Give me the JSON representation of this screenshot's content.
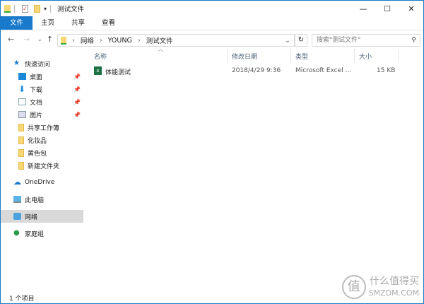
{
  "window": {
    "title": "测试文件",
    "minimize": "—",
    "maximize": "☐",
    "close": "✕"
  },
  "ribbon": {
    "tabs": [
      "文件",
      "主页",
      "共享",
      "查看"
    ]
  },
  "address": {
    "crumbs": [
      "网络",
      "YOUNG",
      "测试文件"
    ],
    "search_placeholder": "搜索\"测试文件\""
  },
  "nav": {
    "quick_access": "快速访问",
    "pinned": [
      "桌面",
      "下载",
      "文档",
      "图片"
    ],
    "folders": [
      "共享工作簿",
      "化妆品",
      "黄色包",
      "新建文件夹"
    ],
    "onedrive": "OneDrive",
    "this_pc": "此电脑",
    "network": "网络",
    "homegroup": "家庭组"
  },
  "columns": {
    "name": "名称",
    "modified": "修改日期",
    "type": "类型",
    "size": "大小"
  },
  "files": [
    {
      "name": "体能测试",
      "modified": "2018/4/29 9:36",
      "type": "Microsoft Excel ...",
      "size": "15 KB"
    }
  ],
  "status": "1 个项目",
  "watermark": {
    "glyph": "值",
    "line1": "什么值得买",
    "line2": "SMZDM.COM"
  }
}
